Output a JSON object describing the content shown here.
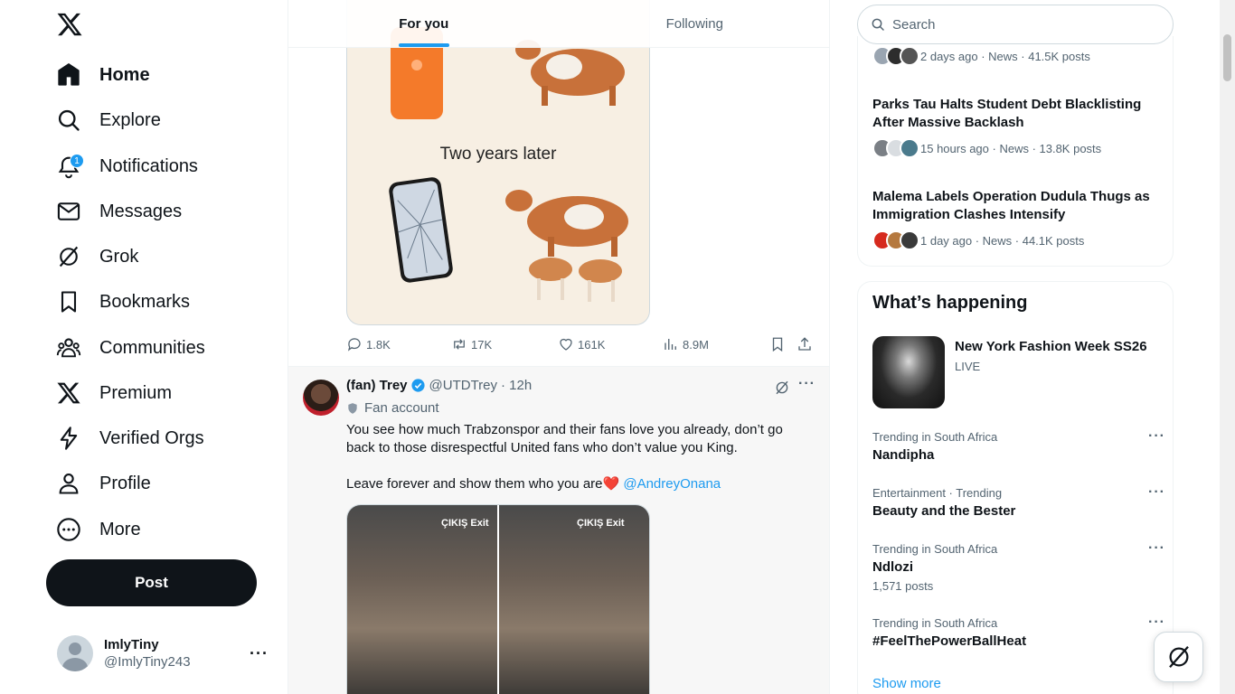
{
  "nav": {
    "items": [
      {
        "label": "Home",
        "icon": "home-icon"
      },
      {
        "label": "Explore",
        "icon": "search-icon"
      },
      {
        "label": "Notifications",
        "icon": "bell-icon",
        "badge": "1"
      },
      {
        "label": "Messages",
        "icon": "envelope-icon"
      },
      {
        "label": "Grok",
        "icon": "grok-icon"
      },
      {
        "label": "Bookmarks",
        "icon": "bookmark-icon"
      },
      {
        "label": "Communities",
        "icon": "people-icon"
      },
      {
        "label": "Premium",
        "icon": "x-logo-icon"
      },
      {
        "label": "Verified Orgs",
        "icon": "lightning-icon"
      },
      {
        "label": "Profile",
        "icon": "person-icon"
      },
      {
        "label": "More",
        "icon": "more-circle-icon"
      }
    ],
    "post_label": "Post",
    "account": {
      "name": "ImlyTiny",
      "handle": "@ImlyTiny243"
    }
  },
  "feed": {
    "tabs": [
      {
        "label": "For you"
      },
      {
        "label": "Following"
      }
    ],
    "tweet1": {
      "media_text": "Two years later",
      "stats": {
        "replies": "1.8K",
        "reposts": "17K",
        "likes": "161K",
        "views": "8.9M"
      }
    },
    "tweet2": {
      "name": "(fan) Trey",
      "handle": "@UTDTrey",
      "time": "· 12h",
      "tag": "Fan account",
      "text1": "You see how much Trabzonspor and their fans love you already, don’t go back to those disrespectful United fans who don’t value you King.",
      "text2": "Leave forever and show them who you are❤️",
      "mention": "@AndreyOnana",
      "sign_text": "ÇIKIŞ Exit"
    }
  },
  "right": {
    "search_placeholder": "Search",
    "news": [
      {
        "meta": "2 days ago · News · 41.5K posts"
      },
      {
        "title": "Parks Tau Halts Student Debt Blacklisting After Massive Backlash",
        "meta": "15 hours ago · News · 13.8K posts"
      },
      {
        "title": "Malema Labels Operation Dudula Thugs as Immigration Clashes Intensify",
        "meta": "1 day ago · News · 44.1K posts"
      }
    ],
    "happening": {
      "title": "What’s happening",
      "event": {
        "title": "New York Fashion Week SS26",
        "status": "LIVE"
      },
      "trends": [
        {
          "context": "Trending in South Africa",
          "name": "Nandipha",
          "count": ""
        },
        {
          "context": "Entertainment · Trending",
          "name": "Beauty and the Bester",
          "count": ""
        },
        {
          "context": "Trending in South Africa",
          "name": "Ndlozi",
          "count": "1,571 posts"
        },
        {
          "context": "Trending in South Africa",
          "name": "#FeelThePowerBallHeat",
          "count": ""
        }
      ],
      "show_more": "Show more"
    }
  },
  "colors": {
    "accent": "#1d9bf0",
    "text": "#0f1419",
    "muted": "#536471",
    "like_heart": "#f91880"
  }
}
